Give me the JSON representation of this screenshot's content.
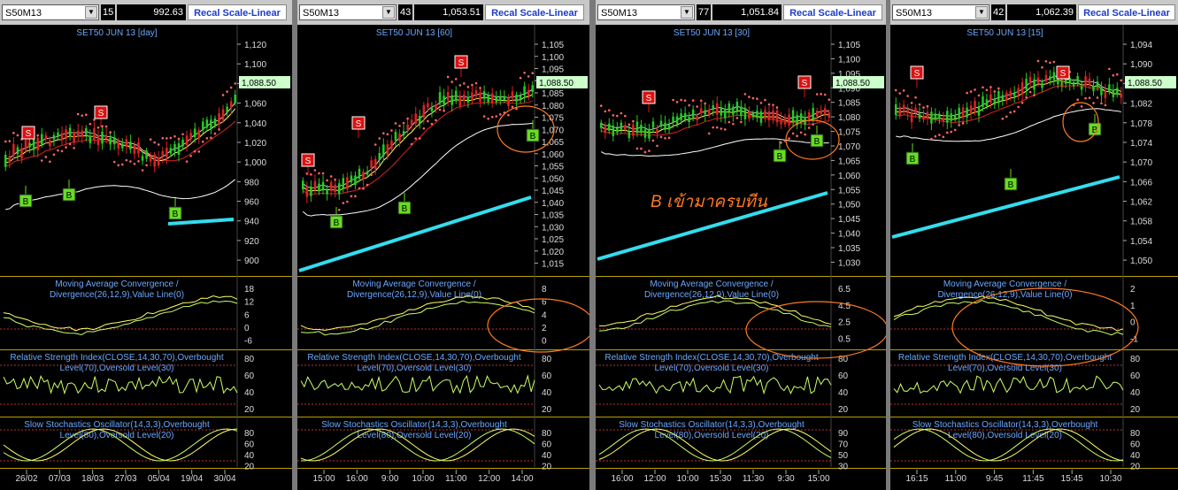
{
  "panels": [
    {
      "symbol": "S50M13",
      "interval_count": "15",
      "last_price": "992.63",
      "recal_label": "Recal Scale-Linear",
      "title": "SET50 JUN 13  [day]",
      "price_tag": "1,088.50",
      "price_ticks": [
        "1,120",
        "1,100",
        "1,080",
        "1,060",
        "1,040",
        "1,020",
        "1,000",
        "980",
        "960",
        "940",
        "920",
        "900"
      ],
      "macd_ticks": [
        "18",
        "12",
        "6",
        "0",
        "-6"
      ],
      "rsi_ticks": [
        "80",
        "60",
        "40",
        "20"
      ],
      "stoch_ticks": [
        "80",
        "60",
        "40",
        "20"
      ],
      "time_ticks": [
        "26/02",
        "07/03",
        "18/03",
        "27/03",
        "05/04",
        "19/04",
        "30/04"
      ],
      "signals": [
        {
          "label": "S",
          "type": "sell"
        },
        {
          "label": "S",
          "type": "sell"
        },
        {
          "label": "B",
          "type": "buy"
        },
        {
          "label": "B",
          "type": "buy"
        },
        {
          "label": "B",
          "type": "buy"
        }
      ]
    },
    {
      "symbol": "S50M13",
      "interval_count": "43",
      "last_price": "1,053.51",
      "recal_label": "Recal Scale-Linear",
      "title": "SET50 JUN 13  [60]",
      "price_tag": "1,088.50",
      "price_ticks": [
        "1,105",
        "1,100",
        "1,095",
        "1,090",
        "1,085",
        "1,080",
        "1,075",
        "1,070",
        "1,065",
        "1,060",
        "1,055",
        "1,050",
        "1,045",
        "1,040",
        "1,035",
        "1,030",
        "1,025",
        "1,020",
        "1,015"
      ],
      "macd_ticks": [
        "8",
        "6",
        "4",
        "2",
        "0"
      ],
      "rsi_ticks": [
        "80",
        "60",
        "40",
        "20"
      ],
      "stoch_ticks": [
        "80",
        "60",
        "40",
        "20"
      ],
      "time_ticks": [
        "15:00",
        "16:00",
        "9:00",
        "10:00",
        "11:00",
        "12:00",
        "14:00"
      ],
      "signals": [
        {
          "label": "S",
          "type": "sell"
        },
        {
          "label": "S",
          "type": "sell"
        },
        {
          "label": "S",
          "type": "sell"
        },
        {
          "label": "B",
          "type": "buy"
        },
        {
          "label": "B",
          "type": "buy"
        },
        {
          "label": "B",
          "type": "buy"
        }
      ]
    },
    {
      "symbol": "S50M13",
      "interval_count": "77",
      "last_price": "1,051.84",
      "recal_label": "Recal Scale-Linear",
      "title": "SET50 JUN 13  [30]",
      "price_tag": "1,088.50",
      "price_ticks": [
        "1,105",
        "1,100",
        "1,095",
        "1,090",
        "1,085",
        "1,080",
        "1,075",
        "1,070",
        "1,065",
        "1,060",
        "1,055",
        "1,050",
        "1,045",
        "1,040",
        "1,035",
        "1,030"
      ],
      "macd_ticks": [
        "6.5",
        "4.5",
        "2.5",
        "0.5"
      ],
      "rsi_ticks": [
        "80",
        "60",
        "40",
        "20"
      ],
      "stoch_ticks": [
        "90",
        "70",
        "50",
        "30"
      ],
      "time_ticks": [
        "16:00",
        "12:00",
        "10:00",
        "15:30",
        "11:30",
        "9:30",
        "15:00"
      ],
      "annotation": "B เข้ามาครบทีน",
      "signals": [
        {
          "label": "S",
          "type": "sell"
        },
        {
          "label": "S",
          "type": "sell"
        },
        {
          "label": "B",
          "type": "buy"
        },
        {
          "label": "B",
          "type": "buy"
        }
      ]
    },
    {
      "symbol": "S50M13",
      "interval_count": "42",
      "last_price": "1,062.39",
      "recal_label": "Recal Scale-Linear",
      "title": "SET50 JUN 13  [15]",
      "price_tag": "1,088.50",
      "price_ticks": [
        "1,094",
        "1,090",
        "1,086",
        "1,082",
        "1,078",
        "1,074",
        "1,070",
        "1,066",
        "1,062",
        "1,058",
        "1,054",
        "1,050"
      ],
      "macd_ticks": [
        "2",
        "1",
        "0",
        "-1"
      ],
      "rsi_ticks": [
        "80",
        "60",
        "40",
        "20"
      ],
      "stoch_ticks": [
        "80",
        "60",
        "40",
        "20"
      ],
      "time_ticks": [
        "16:15",
        "11:00",
        "9:45",
        "11:45",
        "15:45",
        "10:30"
      ],
      "signals": [
        {
          "label": "S",
          "type": "sell"
        },
        {
          "label": "S",
          "type": "sell"
        },
        {
          "label": "B",
          "type": "buy"
        },
        {
          "label": "B",
          "type": "buy"
        },
        {
          "label": "B",
          "type": "buy"
        }
      ]
    }
  ],
  "indicator_titles": {
    "macd_line1": "Moving Average Convergence /",
    "macd_line2": "Divergence(26,12,9),Value Line(0)",
    "rsi_line1": "Relative Strength Index(CLOSE,14,30,70),Overbought",
    "rsi_line2": "Level(70),Oversold Level(30)",
    "stoch_line1": "Slow Stochastics Oscillator(14,3,3),Overbought",
    "stoch_line2": "Level(80),Oversold Level(20)"
  },
  "colors": {
    "background": "#000000",
    "bull_candle": "#22cc22",
    "bear_candle": "#dd2222",
    "sar_dots": "#ff6666",
    "ma_slow": "#ffffff",
    "ma_mid": "#dd2222",
    "ma_fast": "#ffff66",
    "trend_line": "#33ddee",
    "indicator_line": "#ffff66",
    "signal_line": "#ccff66",
    "grid_line": "#8a6a00",
    "sell_badge": "#dd1111",
    "buy_badge": "#66dd22",
    "label_text": "#6aa8ff",
    "annotation": "#ff7a22"
  },
  "chart_data": [
    {
      "type": "line",
      "title": "SET50 JUN 13  [day]",
      "x": [
        "26/02",
        "07/03",
        "18/03",
        "27/03",
        "05/04",
        "19/04",
        "30/04"
      ],
      "series": []
    },
    {
      "type": "line",
      "title": "SET50 JUN 13  [60]",
      "x": [
        "15:00",
        "16:00",
        "9:00",
        "10:00",
        "11:00",
        "12:00",
        "14:00"
      ],
      "series": []
    },
    {
      "type": "line",
      "title": "SET50 JUN 13  [30]",
      "x": [
        "16:00",
        "12:00",
        "10:00",
        "15:30",
        "11:30",
        "9:30",
        "15:00"
      ],
      "series": []
    },
    {
      "type": "line",
      "title": "SET50 JUN 13  [15]",
      "x": [
        "16:15",
        "11:00",
        "9:45",
        "11:45",
        "15:45",
        "10:30"
      ],
      "series": []
    }
  ]
}
